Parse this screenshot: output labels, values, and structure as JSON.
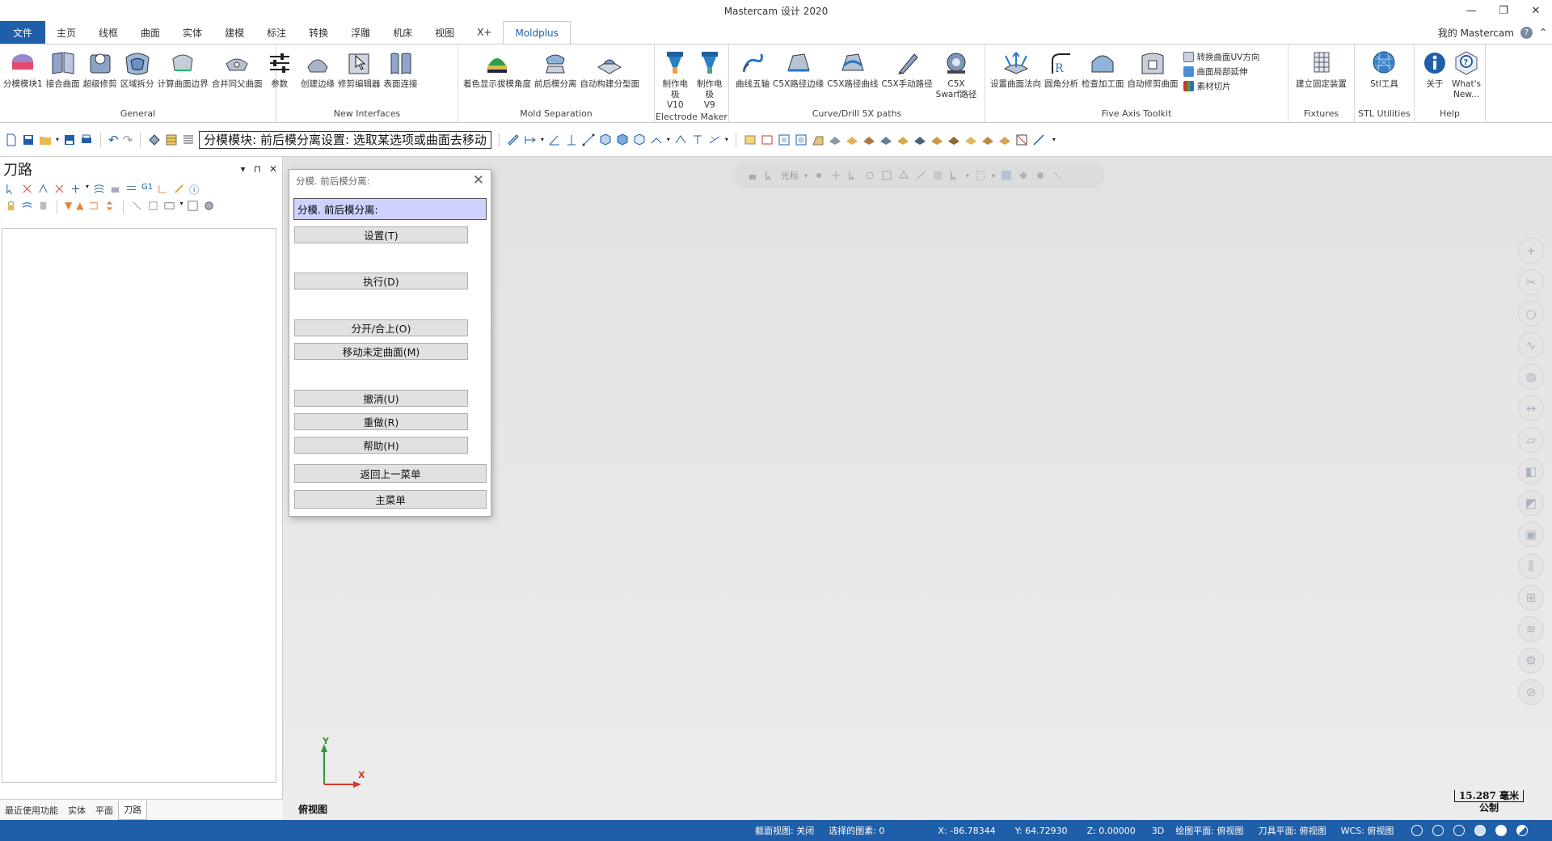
{
  "window": {
    "title": "Mastercam 设计 2020",
    "controls": [
      "—",
      "❐",
      "✕"
    ]
  },
  "tabs": {
    "file": "文件",
    "items": [
      "主页",
      "线框",
      "曲面",
      "实体",
      "建模",
      "标注",
      "转换",
      "浮雕",
      "机床",
      "视图",
      "X+"
    ],
    "active": "Moldplus",
    "account": "我的 Mastercam",
    "help": "?",
    "collapse": "⌃"
  },
  "ribbon": {
    "general": {
      "label": "General",
      "items": [
        "分模模块1",
        "接合曲面",
        "超级修剪",
        "区域拆分",
        "计算曲面边界",
        "合并同父曲面",
        "参数"
      ]
    },
    "new_interfaces": {
      "label": "New Interfaces",
      "items": [
        "创建边缘",
        "修剪编辑器",
        "表面连接"
      ]
    },
    "mold_separation": {
      "label": "Mold Separation",
      "items": [
        "着色显示拔模角度",
        "前后模分离",
        "自动构建分型面"
      ]
    },
    "electrode": {
      "label": "Electrode Maker",
      "items": [
        "制作电极\nV10",
        "制作电极\nV9"
      ]
    },
    "curve5x": {
      "label": "Curve/Drill 5X paths",
      "items": [
        "曲线五轴",
        "C5X路径边缘",
        "C5X路径曲线",
        "C5X手动路径",
        "C5X\nSwarf路径"
      ]
    },
    "five_axis": {
      "label": "Five Axis Toolkit",
      "items": [
        "设置曲面法向",
        "圆角分析",
        "检查加工面",
        "自动修剪曲面"
      ],
      "small": [
        "转换曲面UV方向",
        "曲面局部延伸",
        "素材切片"
      ]
    },
    "fixtures": {
      "label": "Fixtures",
      "items": [
        "建立固定装置"
      ]
    },
    "stl": {
      "label": "STL Utilities",
      "items": [
        "Stl工具"
      ]
    },
    "help": {
      "label": "Help",
      "items": [
        "关于",
        "What's\nNew..."
      ]
    }
  },
  "toolbar": {
    "prompt": "分模模块: 前后模分离设置: 选取某选项或曲面去移动"
  },
  "left_panel": {
    "title": "刀路",
    "controls": [
      "▾",
      "⊓",
      "✕"
    ],
    "bottom_tabs": [
      "最近使用功能",
      "实体",
      "平面",
      "刀路"
    ],
    "active_tab": "刀路"
  },
  "viewport": {
    "floating_toolbar_text": "光标",
    "axis_y": "Y",
    "axis_x": "X",
    "view_name": "俯视图",
    "scale_value": "15.287 毫米",
    "scale_unit": "公制"
  },
  "dialog": {
    "title": "分模. 前后模分离:",
    "header": "分模. 前后模分离:",
    "close": "✕",
    "buttons": {
      "settings": "设置(T)",
      "execute": "执行(D)",
      "split": "分开/合上(O)",
      "move": "移动未定曲面(M)",
      "undo": "撤消(U)",
      "redo": "重做(R)",
      "help": "帮助(H)",
      "back": "返回上一菜单",
      "main": "主菜单"
    }
  },
  "status": {
    "section_view": "截面视图: 关闭",
    "selected": "选择的图素: 0",
    "x": "X:  -86.78344",
    "y": "Y:  64.72930",
    "z": "Z:  0.00000",
    "mode": "3D",
    "plane": "绘图平面: 俯视图",
    "tool_plane": "刀具平面: 俯视图",
    "wcs": "WCS: 俯视图"
  },
  "colors": {
    "accent": "#1f5ea8",
    "dialog_header": "#cfd2ff"
  }
}
